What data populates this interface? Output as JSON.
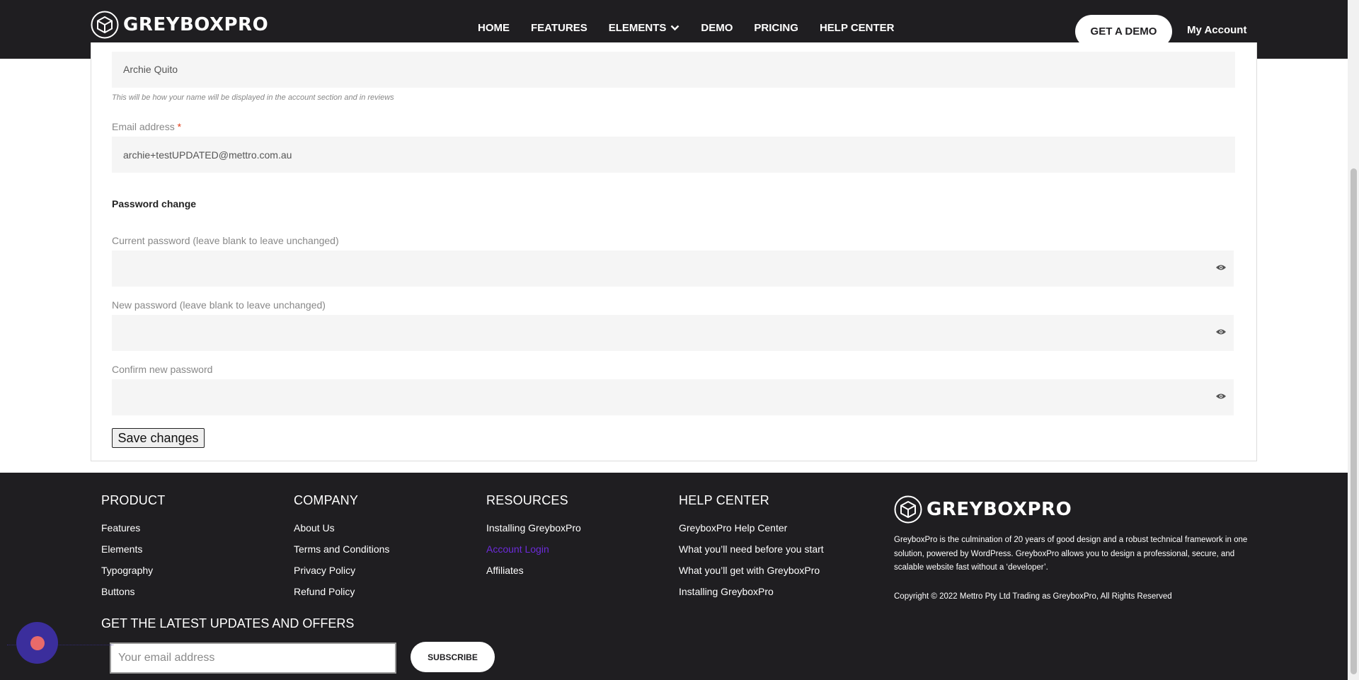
{
  "header": {
    "logo_text": "GREYBOXPRO",
    "nav": [
      {
        "label": "HOME"
      },
      {
        "label": "FEATURES"
      },
      {
        "label": "ELEMENTS"
      },
      {
        "label": "DEMO"
      },
      {
        "label": "PRICING"
      },
      {
        "label": "HELP CENTER"
      }
    ],
    "cta_label": "GET A DEMO",
    "account_label": "My Account"
  },
  "form": {
    "display_name_value": "Archie Quito",
    "display_name_hint": "This will be how your name will be displayed in the account section and in reviews",
    "email_label": "Email address",
    "email_required_mark": "*",
    "email_value": "archie+testUPDATED@mettro.com.au",
    "password_section_title": "Password change",
    "current_password_label": "Current password (leave blank to leave unchanged)",
    "new_password_label": "New password (leave blank to leave unchanged)",
    "confirm_password_label": "Confirm new password",
    "save_label": "Save changes"
  },
  "footer": {
    "columns": [
      {
        "title": "PRODUCT",
        "links": [
          "Features",
          "Elements",
          "Typography",
          "Buttons"
        ]
      },
      {
        "title": "COMPANY",
        "links": [
          "About Us",
          "Terms and Conditions",
          "Privacy Policy",
          "Refund Policy"
        ]
      },
      {
        "title": "RESOURCES",
        "links": [
          "Installing GreyboxPro",
          "Account Login",
          "Affiliates"
        ]
      },
      {
        "title": "HELP CENTER",
        "links": [
          "GreyboxPro Help Center",
          "What you’ll need before you start",
          "What you’ll get with GreyboxPro",
          "Installing GreyboxPro"
        ]
      }
    ],
    "logo_text": "GREYBOXPRO",
    "description": "GreyboxPro is the culmination of 20 years of good design and a robust technical framework in one solution, powered by WordPress. GreyboxPro allows you to design a professional, secure, and scalable website fast without a ‘developer’.",
    "copyright": "Copyright © 2022 Mettro Pty Ltd Trading as GreyboxPro, All Rights Reserved",
    "updates_title": "GET THE LATEST UPDATES AND OFFERS",
    "email_placeholder": "Your email address",
    "subscribe_label": "SUBSCRIBE"
  },
  "colors": {
    "dark_bg": "#1f1e21",
    "field_bg": "#f5f5f5",
    "link_purple": "#6c2bd9",
    "required_red": "#e2401c",
    "chat_bubble": "#3b2e9c"
  },
  "icons": [
    "cube-logo-icon",
    "chevron-down-icon",
    "eye-icon",
    "chat-icon"
  ]
}
